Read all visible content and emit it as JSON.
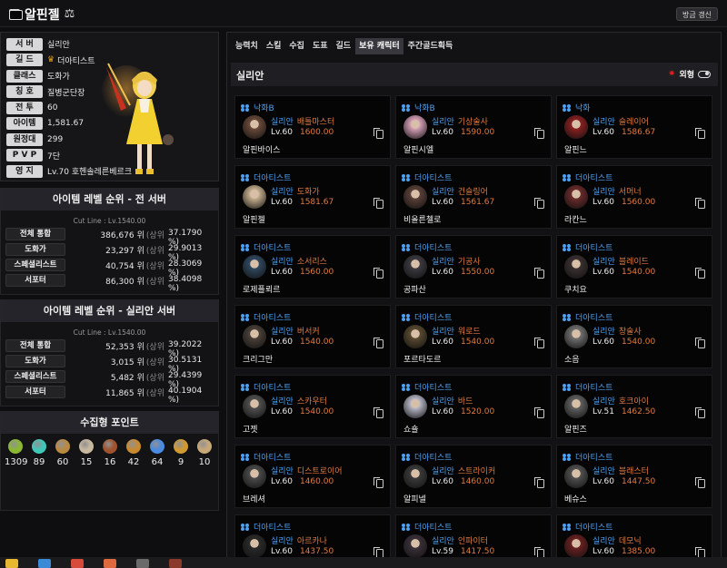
{
  "header": {
    "title": "알핀젤",
    "refresh_label": "방금 갱신"
  },
  "profile": {
    "rows": [
      {
        "key": "서 버",
        "value": "실리안"
      },
      {
        "key": "길 드",
        "value": "더아티스트",
        "crown": true
      },
      {
        "key": "클래스",
        "value": "도화가"
      },
      {
        "key": "칭 호",
        "value": "질병군단장"
      },
      {
        "key": "전 투",
        "value": "60"
      },
      {
        "key": "아이템",
        "value": "1,581.67"
      },
      {
        "key": "원정대",
        "value": "299"
      },
      {
        "key": "P V P",
        "value": "7단"
      },
      {
        "key": "영 지",
        "value": "Lv.70 호헨솔레른베르크"
      }
    ]
  },
  "ranking_all": {
    "title": "아이템 레벨 순위 - 전 서버",
    "cutline": "Cut Line : Lv.1540.00",
    "unit": "위",
    "sangwi": "(상위",
    "rows": [
      {
        "label": "전체 통합",
        "rank": "386,676",
        "pct": "37.1790 %)"
      },
      {
        "label": "도화가",
        "rank": "23,297",
        "pct": "29.9013 %)"
      },
      {
        "label": "스페셜리스트",
        "rank": "40,754",
        "pct": "28.3069 %)"
      },
      {
        "label": "서포터",
        "rank": "86,300",
        "pct": "38.4098 %)"
      }
    ]
  },
  "ranking_server": {
    "title": "아이템 레벨 순위 - 실리안 서버",
    "cutline": "Cut Line : Lv.1540.00",
    "unit": "위",
    "sangwi": "(상위",
    "rows": [
      {
        "label": "전체 통합",
        "rank": "52,353",
        "pct": "39.2022 %)"
      },
      {
        "label": "도화가",
        "rank": "3,015",
        "pct": "30.5131 %)"
      },
      {
        "label": "스페셜리스트",
        "rank": "5,482",
        "pct": "29.4399 %)"
      },
      {
        "label": "서포터",
        "rank": "11,865",
        "pct": "40.1904 %)"
      }
    ]
  },
  "collect": {
    "title": "수집형 포인트",
    "items": [
      {
        "icon": "mokoko-seed-icon",
        "value": "1309",
        "color": "#8ab832"
      },
      {
        "icon": "island-heart-icon",
        "value": "89",
        "color": "#3fc8b8"
      },
      {
        "icon": "masterpiece-icon",
        "value": "60",
        "color": "#b88a40"
      },
      {
        "icon": "giant-heart-icon",
        "value": "15",
        "color": "#c8b8a0"
      },
      {
        "icon": "ignea-token-icon",
        "value": "16",
        "color": "#a0522d"
      },
      {
        "icon": "sea-bounty-icon",
        "value": "42",
        "color": "#c88a30"
      },
      {
        "icon": "world-tree-leaf-icon",
        "value": "64",
        "color": "#4a8ae0"
      },
      {
        "icon": "orpheus-star-icon",
        "value": "9",
        "color": "#d09a30"
      },
      {
        "icon": "omnium-star-icon",
        "value": "10",
        "color": "#c8a878"
      }
    ]
  },
  "tabs": [
    {
      "label": "능력치"
    },
    {
      "label": "스킬"
    },
    {
      "label": "수집"
    },
    {
      "label": "도표"
    },
    {
      "label": "길드"
    },
    {
      "label": "보유 캐릭터",
      "active": true
    },
    {
      "label": "주간골드획득"
    }
  ],
  "server_section": {
    "name": "실리안",
    "toggle_label": "외형"
  },
  "level_prefix": "Lv.",
  "characters": [
    {
      "guild": "낙화B",
      "server": "실리안",
      "class": "배틀마스터",
      "level": "60",
      "ilvl": "1600.00",
      "name": "알핀바이스",
      "av": "#6a4a3a"
    },
    {
      "guild": "낙화B",
      "server": "실리안",
      "class": "기상술사",
      "level": "60",
      "ilvl": "1590.00",
      "name": "알핀시엘",
      "av": "#d8a0b8"
    },
    {
      "guild": "낙화",
      "server": "실리안",
      "class": "슬레이어",
      "level": "60",
      "ilvl": "1586.67",
      "name": "알핀느",
      "av": "#8a2020"
    },
    {
      "guild": "더아티스트",
      "server": "실리안",
      "class": "도화가",
      "level": "60",
      "ilvl": "1581.67",
      "name": "알핀젤",
      "av": "#c8b090"
    },
    {
      "guild": "더아티스트",
      "server": "실리안",
      "class": "건슬링어",
      "level": "60",
      "ilvl": "1561.67",
      "name": "비올른첼로",
      "av": "#5a4038"
    },
    {
      "guild": "더아티스트",
      "server": "실리안",
      "class": "서머너",
      "level": "60",
      "ilvl": "1560.00",
      "name": "라칸느",
      "av": "#6a2a2a"
    },
    {
      "guild": "더아티스트",
      "server": "실리안",
      "class": "소서리스",
      "level": "60",
      "ilvl": "1560.00",
      "name": "로제플뢰르",
      "av": "#304860"
    },
    {
      "guild": "더아티스트",
      "server": "실리안",
      "class": "기공사",
      "level": "60",
      "ilvl": "1550.00",
      "name": "공파산",
      "av": "#3a3a40"
    },
    {
      "guild": "더아티스트",
      "server": "실리안",
      "class": "블레이드",
      "level": "60",
      "ilvl": "1540.00",
      "name": "쿠치요",
      "av": "#3a3030"
    },
    {
      "guild": "더아티스트",
      "server": "실리안",
      "class": "버서커",
      "level": "60",
      "ilvl": "1540.00",
      "name": "크리그만",
      "av": "#4a4038"
    },
    {
      "guild": "더아티스트",
      "server": "실리안",
      "class": "워로드",
      "level": "60",
      "ilvl": "1540.00",
      "name": "포르타도르",
      "av": "#5a4a30"
    },
    {
      "guild": "더아티스트",
      "server": "실리안",
      "class": "창술사",
      "level": "60",
      "ilvl": "1540.00",
      "name": "소음",
      "av": "#707070"
    },
    {
      "guild": "더아티스트",
      "server": "실리안",
      "class": "스카우터",
      "level": "60",
      "ilvl": "1540.00",
      "name": "고젯",
      "av": "#505050"
    },
    {
      "guild": "더아티스트",
      "server": "실리안",
      "class": "바드",
      "level": "60",
      "ilvl": "1520.00",
      "name": "쇼숄",
      "av": "#b8b8c8"
    },
    {
      "guild": "더아티스트",
      "server": "실리안",
      "class": "호크아이",
      "level": "51",
      "ilvl": "1462.50",
      "name": "알핀즈",
      "av": "#606060"
    },
    {
      "guild": "더아티스트",
      "server": "실리안",
      "class": "디스트로이어",
      "level": "60",
      "ilvl": "1460.00",
      "name": "브레셔",
      "av": "#4a4a4a"
    },
    {
      "guild": "더아티스트",
      "server": "실리안",
      "class": "스트라이커",
      "level": "60",
      "ilvl": "1460.00",
      "name": "알피넬",
      "av": "#3a3a3a"
    },
    {
      "guild": "더아티스트",
      "server": "실리안",
      "class": "블래스터",
      "level": "60",
      "ilvl": "1447.50",
      "name": "베슈스",
      "av": "#505050"
    },
    {
      "guild": "더아티스트",
      "server": "실리안",
      "class": "아르카나",
      "level": "60",
      "ilvl": "1437.50",
      "name": "",
      "av": "#2a2a2a"
    },
    {
      "guild": "더아티스트",
      "server": "실리안",
      "class": "인파이터",
      "level": "59",
      "ilvl": "1417.50",
      "name": "",
      "av": "#3a3038"
    },
    {
      "guild": "더아티스트",
      "server": "실리안",
      "class": "데모닉",
      "level": "60",
      "ilvl": "1385.00",
      "name": "",
      "av": "#6a2020"
    }
  ],
  "taskbar": [
    {
      "icon": "folder-icon",
      "color": "#e8b830"
    },
    {
      "icon": "store-icon",
      "color": "#3a8ad8"
    },
    {
      "icon": "chrome-icon",
      "color": "#d84a3a"
    },
    {
      "icon": "app-icon",
      "color": "#e06a40"
    },
    {
      "icon": "game-icon",
      "color": "#6a6a6a"
    },
    {
      "icon": "lostark-icon",
      "color": "#8a3a2a"
    }
  ]
}
